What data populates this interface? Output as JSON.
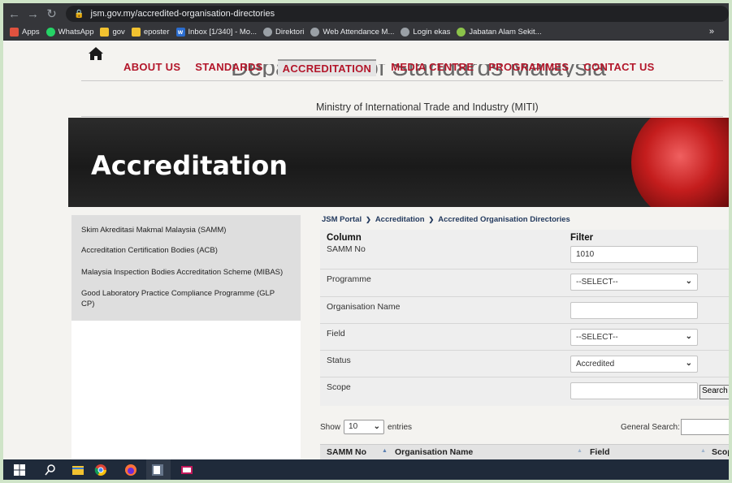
{
  "browser": {
    "url": "jsm.gov.my/accredited-organisation-directories",
    "bookmarks": [
      {
        "label": "Apps",
        "color": "#e0523f"
      },
      {
        "label": "WhatsApp",
        "color": "#25d366"
      },
      {
        "label": "gov",
        "color": "#f2c230"
      },
      {
        "label": "eposter",
        "color": "#f2c230"
      },
      {
        "label": "Inbox [1/340] - Mo...",
        "color": "#2b6dcf"
      },
      {
        "label": "Direktori",
        "color": "#9aa0a6"
      },
      {
        "label": "Web Attendance M...",
        "color": "#9aa0a6"
      },
      {
        "label": "Login ekas",
        "color": "#9aa0a6"
      },
      {
        "label": "Jabatan Alam Sekit...",
        "color": "#8bc34a"
      }
    ],
    "more": "»"
  },
  "nav": {
    "items": [
      "ABOUT US",
      "STANDARDS",
      "ACCREDITATION",
      "MEDIA CENTRE",
      "PROGRAMMES",
      "CONTACT US"
    ]
  },
  "header": {
    "department": "Department of Standards Malaysia",
    "ministry": "Ministry of International Trade and Industry (MITI)",
    "banner_title": "Accreditation"
  },
  "sidebar": {
    "items": [
      "Skim Akreditasi Makmal Malaysia (SAMM)",
      "Accreditation Certification Bodies (ACB)",
      "Malaysia Inspection Bodies Accreditation Scheme (MIBAS)",
      "Good Laboratory Practice Compliance Programme (GLP CP)"
    ]
  },
  "breadcrumb": [
    "JSM Portal",
    "Accreditation",
    "Accredited Organisation Directories"
  ],
  "filters": {
    "col_header": "Column",
    "filter_header": "Filter",
    "rows": [
      {
        "label": "SAMM No",
        "type": "input",
        "value": "1010"
      },
      {
        "label": "Programme",
        "type": "select",
        "value": "--SELECT--"
      },
      {
        "label": "Organisation Name",
        "type": "input",
        "value": ""
      },
      {
        "label": "Field",
        "type": "select",
        "value": "--SELECT--"
      },
      {
        "label": "Status",
        "type": "select",
        "value": "Accredited"
      },
      {
        "label": "Scope",
        "type": "input",
        "value": ""
      }
    ],
    "search_label": "Search"
  },
  "listing": {
    "show_label": "Show",
    "entries_value": "10",
    "entries_label": "entries",
    "general_search_label": "General Search:",
    "columns": [
      "SAMM No",
      "Organisation Name",
      "Field",
      "Scope"
    ]
  }
}
